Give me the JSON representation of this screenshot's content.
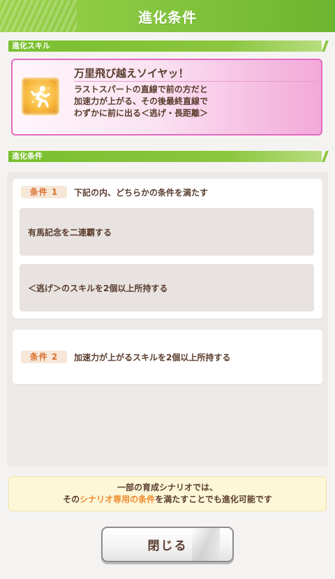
{
  "header": {
    "title": "進化条件"
  },
  "skill_section": {
    "label": "進化スキル"
  },
  "skill": {
    "name": "万里飛び越えソイヤッ！",
    "desc_line1": "ラストスパートの直線で前の方だと",
    "desc_line2": "加速力が上がる、その後最終直線で",
    "desc_line3": "わずかに前に出る＜逃げ・長距離＞",
    "icon": "running-figure-icon",
    "accent": "#e36ac0"
  },
  "conditions_section": {
    "label": "進化条件"
  },
  "conditions": [
    {
      "tag": "条件 1",
      "text": "下記の内、どちらかの条件を満たす",
      "items": [
        "有馬記念を二連覇する",
        "＜逃げ＞のスキルを2個以上所持する"
      ]
    },
    {
      "tag": "条件 2",
      "text": "加速力が上がるスキルを2個以上所持する"
    }
  ],
  "note": {
    "line1": "一部の育成シナリオでは、",
    "line2_pre": "その",
    "line2_hl": "シナリオ専用の条件",
    "line2_post": "を満たすことでも進化可能です",
    "highlight_color": "#ee8a2d"
  },
  "close_button": {
    "label": "閉じる"
  },
  "colors": {
    "header": "#8cc63f",
    "panel": "#f5f3f2",
    "text": "#5a3d2e"
  }
}
